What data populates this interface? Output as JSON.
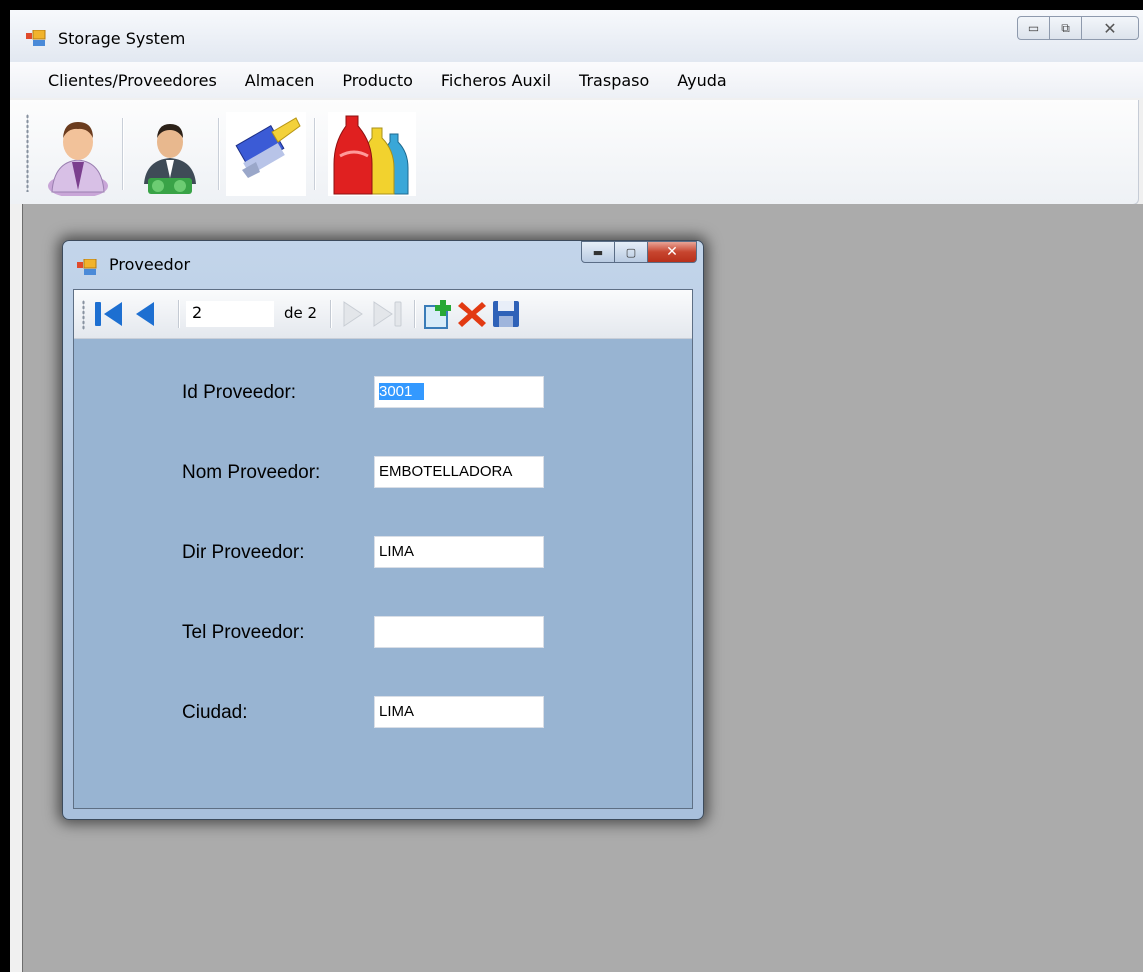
{
  "app": {
    "title": "Storage System"
  },
  "menu": {
    "items": [
      "Clientes/Proveedores",
      "Almacen",
      "Producto",
      "Ficheros Auxil",
      "Traspaso",
      "Ayuda"
    ]
  },
  "toolbar": {
    "icons": [
      "client-person-icon",
      "supplier-person-icon",
      "clean-brush-icon",
      "bottles-product-icon"
    ]
  },
  "child": {
    "title": "Proveedor",
    "navigator": {
      "position": "2",
      "count_label": "de 2"
    },
    "fields": [
      {
        "label": "Id Proveedor:",
        "value": "3001",
        "selected": true
      },
      {
        "label": "Nom Proveedor:",
        "value": "EMBOTELLADORA"
      },
      {
        "label": "Dir Proveedor:",
        "value": "LIMA"
      },
      {
        "label": "Tel Proveedor:",
        "value": ""
      },
      {
        "label": "Ciudad:",
        "value": "LIMA"
      }
    ]
  },
  "colors": {
    "form_background": "#98b4d2",
    "mdi_background": "#ababab",
    "selection": "#3399ff"
  }
}
